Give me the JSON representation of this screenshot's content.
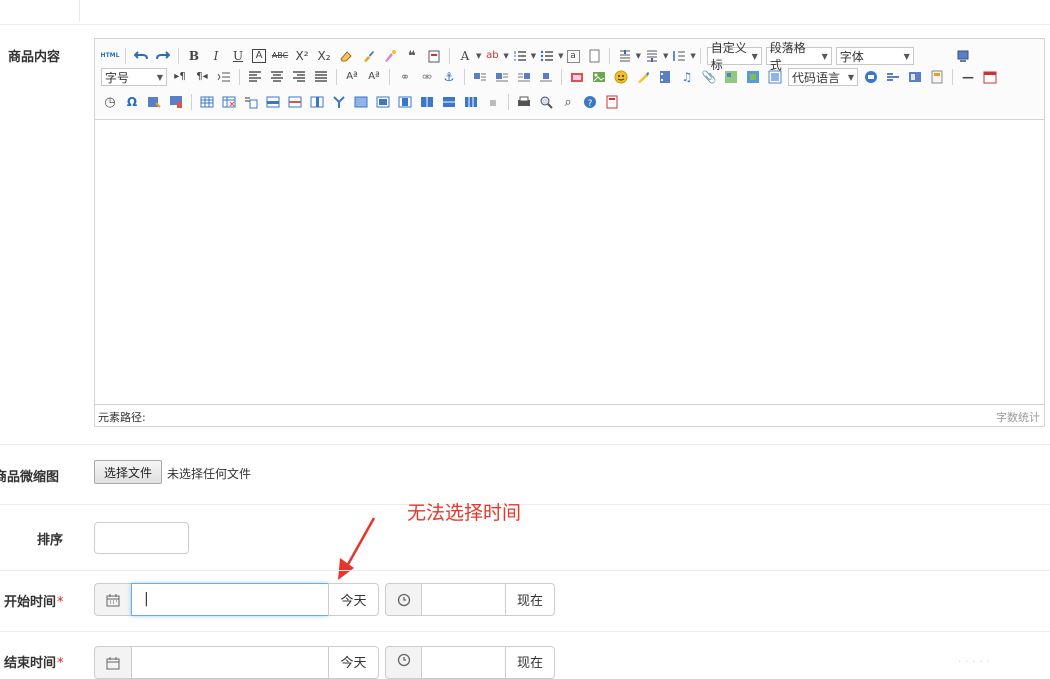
{
  "form": {
    "content_label": "商品内容",
    "thumb_label": "商品微缩图",
    "sort_label": "排序",
    "start_label": "开始时间",
    "end_label": "结束时间",
    "required_mark": "*"
  },
  "editor": {
    "combos": {
      "custom_title": "自定义标",
      "paragraph": "段落格式",
      "font": "字体",
      "font_size": "字号",
      "code_lang": "代码语言"
    },
    "status_path": "元素路径:",
    "word_count": "字数统计"
  },
  "file": {
    "button": "选择文件",
    "status": "未选择任何文件"
  },
  "datetime": {
    "start_value": "|",
    "today": "今天",
    "now": "现在"
  },
  "annotation": "无法选择时间",
  "watermark": "· · · · ·",
  "colors": {
    "accent_red": "#e8352a",
    "focus_blue": "#66afe9"
  },
  "icons": {
    "calendar": "calendar-icon",
    "clock": "clock-icon",
    "arrow": "red-arrow-annotation"
  }
}
